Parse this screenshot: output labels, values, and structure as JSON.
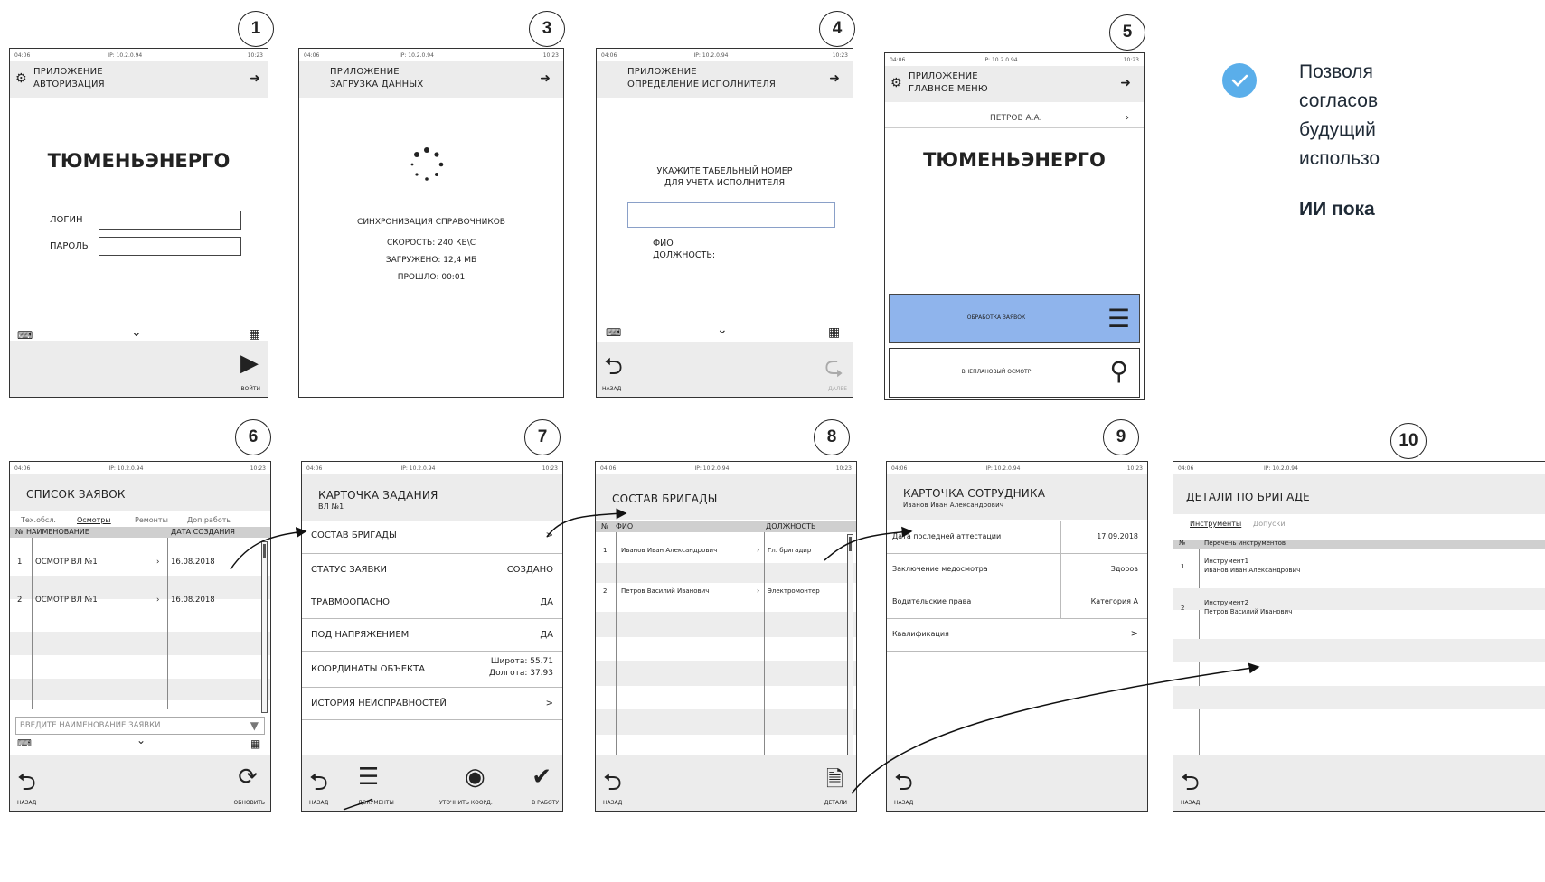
{
  "status": {
    "left": "04:06",
    "ip": "IP: 10.2.0.94",
    "time": "10:23"
  },
  "step_numbers": [
    "1",
    "3",
    "4",
    "5",
    "6",
    "7",
    "8",
    "9",
    "10"
  ],
  "screen1": {
    "app": "ПРИЛОЖЕНИЕ",
    "title": "АВТОРИЗАЦИЯ",
    "brand": "ТЮМЕНЬЭНЕРГО",
    "login_label": "ЛОГИН",
    "password_label": "ПАРОЛЬ",
    "enter_label": "ВОЙТИ"
  },
  "screen3": {
    "app": "ПРИЛОЖЕНИЕ",
    "title": "ЗАГРУЗКА ДАННЫХ",
    "sync": "СИНХРОНИЗАЦИЯ СПРАВОЧНИКОВ",
    "speed": "СКОРОСТЬ: 240 КБ\\С",
    "loaded": "ЗАГРУЖЕНО: 12,4 МБ",
    "elapsed": "ПРОШЛО: 00:01"
  },
  "screen4": {
    "app": "ПРИЛОЖЕНИЕ",
    "title": "ОПРЕДЕЛЕНИЕ ИСПОЛНИТЕЛЯ",
    "prompt1": "УКАЖИТЕ ТАБЕЛЬНЫЙ НОМЕР",
    "prompt2": "ДЛЯ УЧЕТА ИСПОЛНИТЕЛЯ",
    "fio": "ФИО",
    "position": "ДОЛЖНОСТЬ:",
    "back": "НАЗАД",
    "next": "ДАЛЕЕ"
  },
  "screen5": {
    "app": "ПРИЛОЖЕНИЕ",
    "title": "ГЛАВНОЕ МЕНЮ",
    "user": "ПЕТРОВ А.А.",
    "brand": "ТЮМЕНЬЭНЕРГО",
    "btn_requests": "ОБРАБОТКА ЗАЯВОК",
    "btn_inspection": "ВНЕПЛАНОВЫЙ ОСМОТР",
    "accent": "#8fb4ec"
  },
  "screen6": {
    "title": "СПИСОК ЗАЯВОК",
    "tabs": [
      "Тех.обсл.",
      "Осмотры",
      "Ремонты",
      "Доп.работы"
    ],
    "col_no": "№",
    "col_name": "НАИМЕНОВАНИЕ",
    "col_date": "ДАТА СОЗДАНИЯ",
    "rows": [
      {
        "no": "1",
        "name": "ОСМОТР ВЛ №1",
        "date": "16.08.2018"
      },
      {
        "no": "2",
        "name": "ОСМОТР ВЛ №1",
        "date": "16.08.2018"
      }
    ],
    "search_placeholder": "ВВЕДИТЕ НАИМЕНОВАНИЕ ЗАЯВКИ",
    "back": "НАЗАД",
    "refresh": "ОБНОВИТЬ"
  },
  "screen7": {
    "title": "КАРТОЧКА ЗАДАНИЯ",
    "subtitle": "ВЛ №1",
    "rows": [
      {
        "k": "СОСТАВ БРИГАДЫ",
        "v": ">"
      },
      {
        "k": "СТАТУС ЗАЯВКИ",
        "v": "СОЗДАНО"
      },
      {
        "k": "ТРАВМООПАСНО",
        "v": "ДА"
      },
      {
        "k": "ПОД НАПРЯЖЕНИЕМ",
        "v": "ДА"
      },
      {
        "k": "КООРДИНАТЫ ОБЪЕКТА",
        "v": "Широта: 55.71",
        "v2": "Долгота: 37.93"
      },
      {
        "k": "ИСТОРИЯ НЕИСПРАВНОСТЕЙ",
        "v": ">"
      }
    ],
    "back": "НАЗАД",
    "docs": "ДОКУМЕНТЫ",
    "coords": "УТОЧНИТЬ КООРД.",
    "work": "В РАБОТУ"
  },
  "screen8": {
    "title": "СОСТАВ БРИГАДЫ",
    "col_no": "№",
    "col_fio": "ФИО",
    "col_pos": "ДОЛЖНОСТЬ",
    "rows": [
      {
        "no": "1",
        "fio": "Иванов Иван Александрович",
        "pos": "Гл. бригадир"
      },
      {
        "no": "2",
        "fio": "Петров Василий Иванович",
        "pos": "Электромонтер"
      }
    ],
    "back": "НАЗАД",
    "details": "ДЕТАЛИ"
  },
  "screen9": {
    "title": "КАРТОЧКА СОТРУДНИКА",
    "subtitle": "Иванов Иван Александрович",
    "rows": [
      {
        "k": "Дата последней аттестации",
        "v": "17.09.2018"
      },
      {
        "k": "Заключение медосмотра",
        "v": "Здоров"
      },
      {
        "k": "Водительские права",
        "v": "Категория А"
      },
      {
        "k": "Квалификация",
        "v": ">"
      }
    ],
    "back": "НАЗАД"
  },
  "screen10": {
    "title": "ДЕТАЛИ ПО БРИГАДЕ",
    "tabs": [
      "Инструменты",
      "Допуски"
    ],
    "col_no": "№",
    "col_list": "Перечень инструментов",
    "rows": [
      {
        "no": "1",
        "name": "Инструмент1",
        "owner": "Иванов Иван Александрович"
      },
      {
        "no": "2",
        "name": "Инструмент2",
        "owner": "Петров Василий Иванович"
      }
    ],
    "back": "НАЗАД"
  },
  "side": {
    "lines": [
      "Позволя",
      "согласов",
      "будущий",
      "использо"
    ],
    "bold": "ИИ пока",
    "check_color": "#5aaeea"
  }
}
